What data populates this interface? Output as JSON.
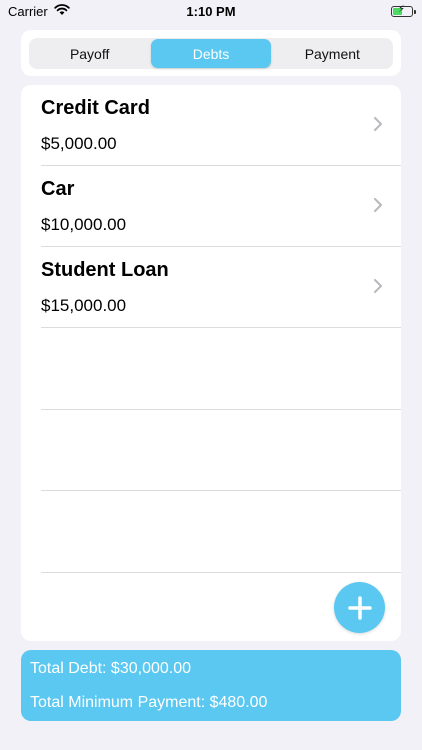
{
  "status_bar": {
    "carrier": "Carrier",
    "time": "1:10 PM",
    "battery_level": 0.5,
    "icons": [
      "wifi-icon",
      "battery-charging-icon"
    ]
  },
  "segments": {
    "items": [
      {
        "label": "Payoff",
        "selected": false
      },
      {
        "label": "Debts",
        "selected": true
      },
      {
        "label": "Payment",
        "selected": false
      }
    ]
  },
  "debts": [
    {
      "name": "Credit Card",
      "amount": "$5,000.00"
    },
    {
      "name": "Car",
      "amount": "$10,000.00"
    },
    {
      "name": "Student Loan",
      "amount": "$15,000.00"
    }
  ],
  "add_button": {
    "icon": "plus-icon"
  },
  "summary": {
    "total_debt": "Total Debt: $30,000.00",
    "total_min_payment": "Total Minimum Payment: $480.00"
  },
  "colors": {
    "accent": "#5ac8f0",
    "background": "#f2f1f7",
    "battery": "#4cd964"
  }
}
